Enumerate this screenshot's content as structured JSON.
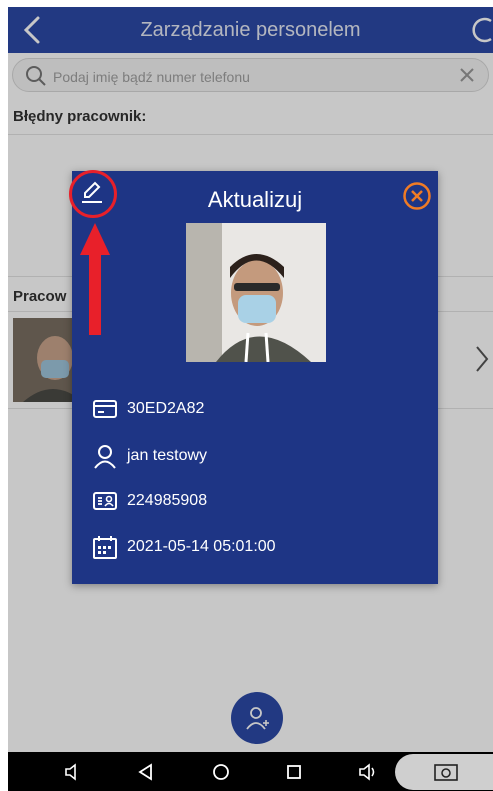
{
  "header": {
    "title": "Zarządzanie personelem"
  },
  "search": {
    "placeholder": "Podaj imię bądź numer telefonu",
    "value": ""
  },
  "sections": {
    "error_employee": "Błędny pracownik:",
    "employees": "Pracow"
  },
  "modal": {
    "title": "Aktualizuj",
    "card_id": "30ED2A82",
    "name": "jan testowy",
    "id_number": "224985908",
    "datetime": "2021-05-14 05:01:00"
  },
  "colors": {
    "header_bg": "#2c4aa7",
    "modal_bg": "#1e3585",
    "accent": "#f07b25",
    "highlight": "#e8202a"
  },
  "icons": {
    "back": "chevron-left-icon",
    "refresh": "refresh-icon",
    "search": "search-icon",
    "clear": "close-icon",
    "edit": "pencil-icon",
    "close": "close-circle-icon",
    "card": "card-icon",
    "person": "person-icon",
    "id": "id-card-icon",
    "calendar": "calendar-icon",
    "add_person": "add-person-icon"
  }
}
